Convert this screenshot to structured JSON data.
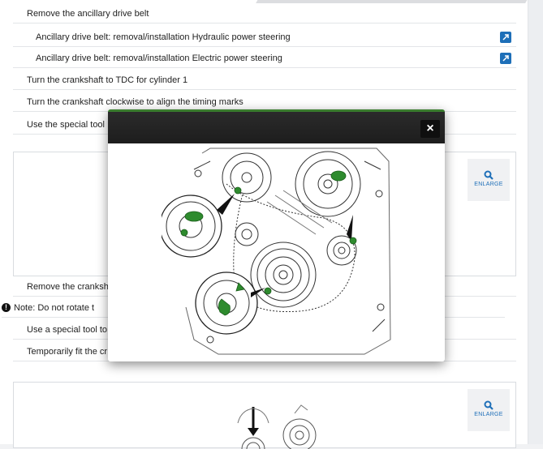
{
  "steps": [
    {
      "text": "Remove the ancillary drive belt"
    },
    {
      "text": "Ancillary drive belt: removal/installation Hydraulic power steering"
    },
    {
      "text": "Ancillary drive belt: removal/installation Electric power steering"
    },
    {
      "text": "Turn the crankshaft to TDC for cylinder 1"
    },
    {
      "text": "Turn the crankshaft clockwise to align the timing marks"
    },
    {
      "text": "Use the special tool"
    },
    {
      "text": "Remove the cranksh"
    },
    {
      "text": "Note: Do not rotate t"
    },
    {
      "text": "Use a special tool to"
    },
    {
      "text": "Temporarily fit the cr"
    }
  ],
  "enlarge_label": "ENLARGE",
  "modal": {
    "close_label": "×"
  },
  "icons": {
    "link": "external-link-icon",
    "note": "exclamation-icon",
    "zoom": "magnifier-icon",
    "close": "close-icon"
  },
  "colors": {
    "accent": "#1e6fb8",
    "modal_header": "#1d1d1d",
    "modal_stripe": "#3a7d2e",
    "highlight": "#2e8b2e"
  }
}
